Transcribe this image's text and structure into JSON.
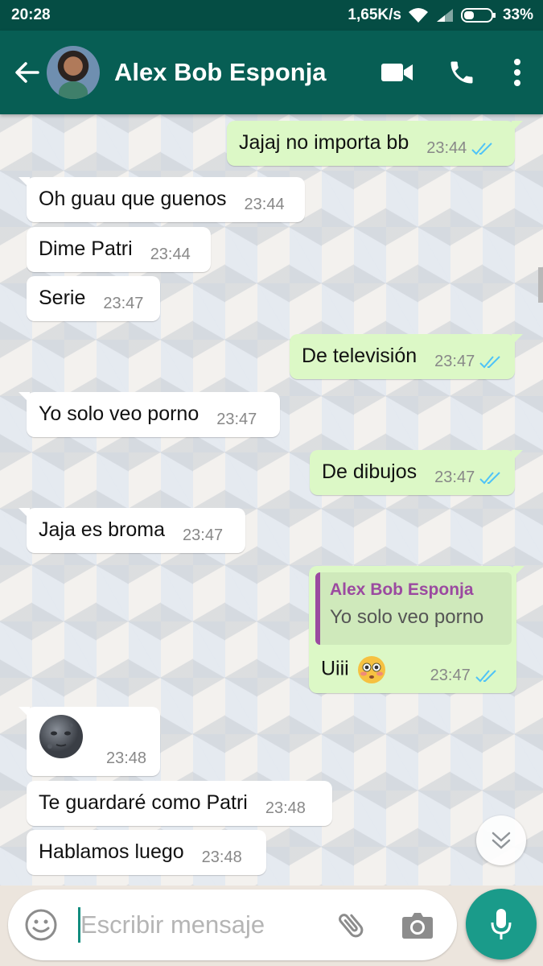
{
  "status_bar": {
    "time": "20:28",
    "network_speed": "1,65K/s",
    "battery": "33%"
  },
  "header": {
    "contact_name": "Alex Bob Esponja",
    "icons": [
      "back-arrow-icon",
      "video-call-icon",
      "phone-icon",
      "more-vert-icon"
    ]
  },
  "messages": [
    {
      "id": "m1",
      "direction": "out",
      "text": "Jajaj no importa bb",
      "time": "23:44",
      "status": "read"
    },
    {
      "id": "m2",
      "direction": "in",
      "text": "Oh guau que guenos",
      "time": "23:44"
    },
    {
      "id": "m3",
      "direction": "in",
      "text": "Dime Patri",
      "time": "23:44"
    },
    {
      "id": "m4",
      "direction": "in",
      "text": "Serie",
      "time": "23:47"
    },
    {
      "id": "m5",
      "direction": "out",
      "text": "De televisión",
      "time": "23:47",
      "status": "read"
    },
    {
      "id": "m6",
      "direction": "in",
      "text": "Yo solo veo porno",
      "time": "23:47"
    },
    {
      "id": "m7",
      "direction": "out",
      "text": "De dibujos",
      "time": "23:47",
      "status": "read"
    },
    {
      "id": "m8",
      "direction": "in",
      "text": "Jaja es broma",
      "time": "23:47"
    },
    {
      "id": "m9",
      "direction": "out",
      "text": "Uiii",
      "time": "23:47",
      "status": "read",
      "emoji": "flushed-face",
      "quote": {
        "author": "Alex Bob Esponja",
        "text": "Yo solo veo porno"
      }
    },
    {
      "id": "m10",
      "direction": "in",
      "emoji": "new-moon-face",
      "time": "23:48"
    },
    {
      "id": "m11",
      "direction": "in",
      "text": "Te guardaré como Patri",
      "time": "23:48"
    },
    {
      "id": "m12",
      "direction": "in",
      "text": "Hablamos luego",
      "time": "23:48"
    }
  ],
  "composer": {
    "placeholder": "Escribir mensaje",
    "value": ""
  },
  "colors": {
    "header": "#075e54",
    "status_bar": "#054d44",
    "outgoing_bubble": "#dcf8c6",
    "incoming_bubble": "#ffffff",
    "read_ticks": "#4fc3f7",
    "accent": "#1a9b8a"
  }
}
